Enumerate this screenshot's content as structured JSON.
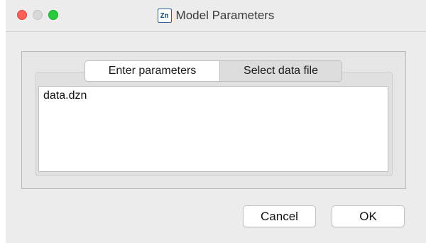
{
  "window": {
    "title": "Model Parameters",
    "app_icon_text": "Zn"
  },
  "tabs": [
    {
      "label": "Enter parameters",
      "active": true
    },
    {
      "label": "Select data file",
      "active": false
    }
  ],
  "editor": {
    "value": "data.dzn"
  },
  "buttons": {
    "cancel_label": "Cancel",
    "ok_label": "OK"
  },
  "colors": {
    "window_background": "#ececec",
    "close": "#fe5f57",
    "minimize_disabled": "#d8d8d8",
    "maximize": "#27c93f"
  }
}
